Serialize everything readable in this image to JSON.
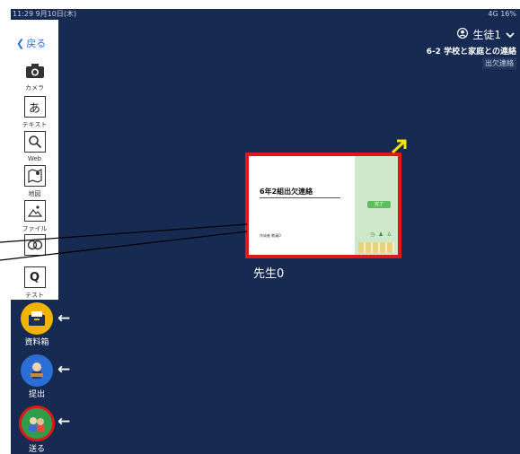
{
  "status": {
    "time": "11:29  9月10日(木)",
    "right": "4G 16%"
  },
  "nav": {
    "back_label": "戻る"
  },
  "tools": [
    {
      "label": "カメラ",
      "icon": "camera-icon",
      "glyph": "▣"
    },
    {
      "label": "テキスト",
      "icon": "text-icon",
      "glyph": "あ"
    },
    {
      "label": "Web",
      "icon": "web-search-icon",
      "glyph": "○"
    },
    {
      "label": "地図",
      "icon": "map-icon",
      "glyph": "⊓"
    },
    {
      "label": "ファイル",
      "icon": "file-icon",
      "glyph": "▭"
    },
    {
      "label": "",
      "icon": "link-icon",
      "glyph": "◎"
    },
    {
      "label": "テスト",
      "icon": "test-icon",
      "glyph": "Q"
    }
  ],
  "header": {
    "user": "生徒1",
    "class_title": "6-2 学校と家庭との連絡",
    "class_sub": "出欠連絡"
  },
  "card": {
    "title": "6年2組出欠連絡",
    "author": "作成者 教員0",
    "button": "完了",
    "owner": "先生0"
  },
  "side": [
    {
      "label": "資料箱",
      "icon": "document-box-icon",
      "color": "#f0b400"
    },
    {
      "label": "提出",
      "icon": "submit-icon",
      "color": "#2b6fd6"
    },
    {
      "label": "送る",
      "icon": "send-icon",
      "color": "#2f9e4a"
    }
  ],
  "colors": {
    "background": "#162a52",
    "highlight": "#e01818",
    "accent_arrow": "#f5e400"
  }
}
